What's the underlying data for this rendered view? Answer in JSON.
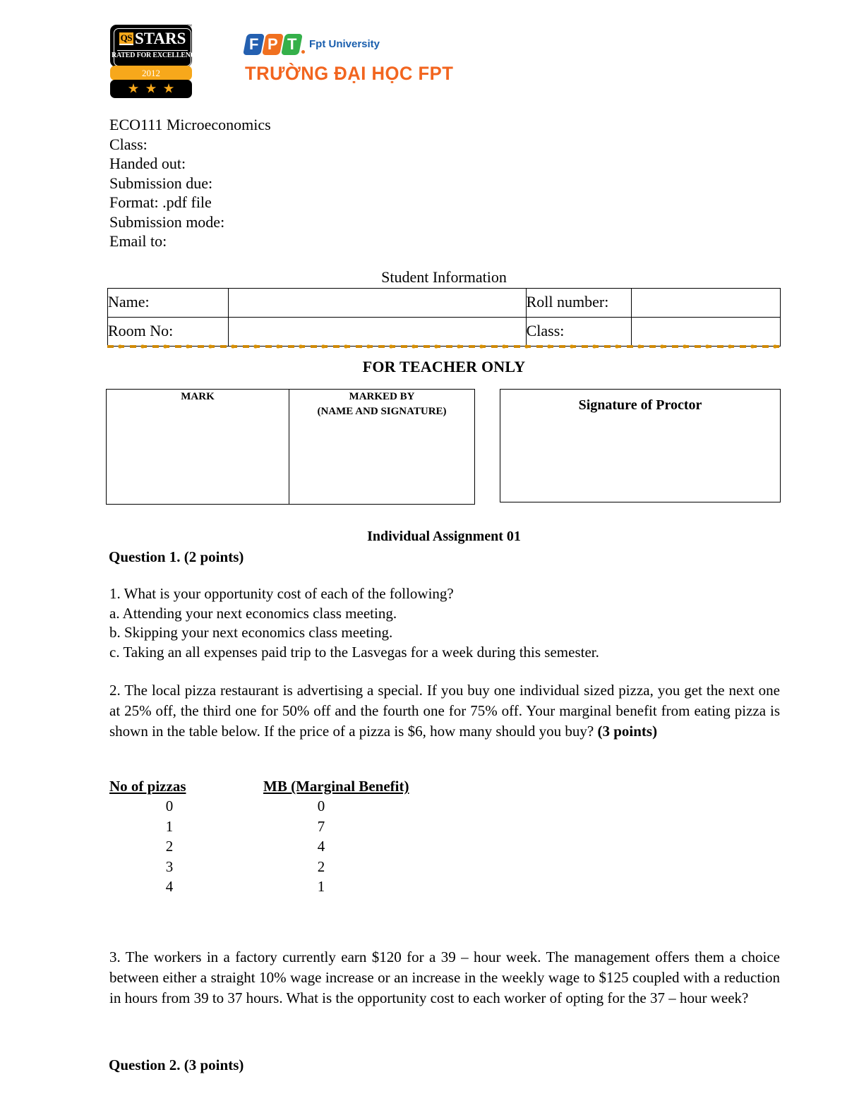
{
  "header": {
    "qs_badge": {
      "mark": "QS",
      "word": "STARS",
      "tagline": "RATED FOR EXCELLENCE",
      "year": "2012",
      "star_count": 3,
      "trademark": "™",
      "accent_color": "#F7A81B",
      "bg_color": "#000000"
    },
    "fpt_logo": {
      "letters": [
        "F",
        "P",
        "T"
      ],
      "letter_colors": [
        "#2460B0",
        "#F07020",
        "#35B04A"
      ],
      "wordmark": "Fpt University",
      "wordmark_color": "#1A5FAE",
      "vietnamese_name": "TRƯỜNG ĐẠI HỌC FPT",
      "vietnamese_color": "#F2651F"
    }
  },
  "course_info": [
    "ECO111 Microeconomics",
    "Class:",
    "Handed out:",
    "Submission due:",
    "Format: .pdf file",
    "Submission mode:",
    "Email to:"
  ],
  "student_information": {
    "title": "Student Information",
    "rows": [
      {
        "label_left": "Name:",
        "value_left": "",
        "label_right": "Roll number:",
        "value_right": ""
      },
      {
        "label_left": "Room No:",
        "value_left": "",
        "label_right": "Class:",
        "value_right": ""
      }
    ]
  },
  "separator": {
    "style": "dash-dot",
    "color": "#D89000"
  },
  "teacher_section": {
    "title": "FOR TEACHER ONLY",
    "mark_header": "MARK",
    "marked_by_header_line1": "MARKED BY",
    "marked_by_header_line2": "(NAME AND SIGNATURE)",
    "mark_value": "",
    "marked_by_value": "",
    "signature_header": "Signature of Proctor",
    "signature_value": ""
  },
  "assignment": {
    "title": "Individual Assignment 01",
    "question1_heading": "Question 1. (2 points)",
    "question1_items": [
      "1. What is your opportunity cost of each of the following?",
      "a. Attending your next economics class meeting.",
      "b. Skipping your next economics class meeting.",
      "c. Taking an all expenses paid trip to the Lasvegas for a week during this semester."
    ],
    "question1_part2_text": "2. The local pizza restaurant is advertising a special. If you buy one individual sized pizza, you get the next one at 25% off, the third one for 50% off and the fourth one for 75% off. Your marginal benefit from eating pizza is shown in the table below. If the price of a pizza is $6, how many should you buy? ",
    "question1_part2_points": "(3 points)",
    "question1_part3_text": "3. The workers in a factory currently earn $120 for a 39 – hour week. The management offers them a choice between either a straight 10% wage increase or an increase in the weekly wage to $125 coupled with a reduction in hours from 39 to 37 hours. What is the opportunity cost to each worker of opting for the 37 – hour week?",
    "question2_heading": "Question 2. (3 points)"
  },
  "chart_data": {
    "type": "table",
    "title": "",
    "columns": [
      "No of pizzas",
      "MB (Marginal Benefit)"
    ],
    "categories": [
      "0",
      "1",
      "2",
      "3",
      "4"
    ],
    "values": [
      0,
      7,
      4,
      2,
      1
    ],
    "rows": [
      {
        "pizzas": "0",
        "mb": "0"
      },
      {
        "pizzas": "1",
        "mb": "7"
      },
      {
        "pizzas": "2",
        "mb": "4"
      },
      {
        "pizzas": "3",
        "mb": "2"
      },
      {
        "pizzas": "4",
        "mb": "1"
      }
    ],
    "xlabel": "No of pizzas",
    "ylabel": "MB (Marginal Benefit)"
  }
}
